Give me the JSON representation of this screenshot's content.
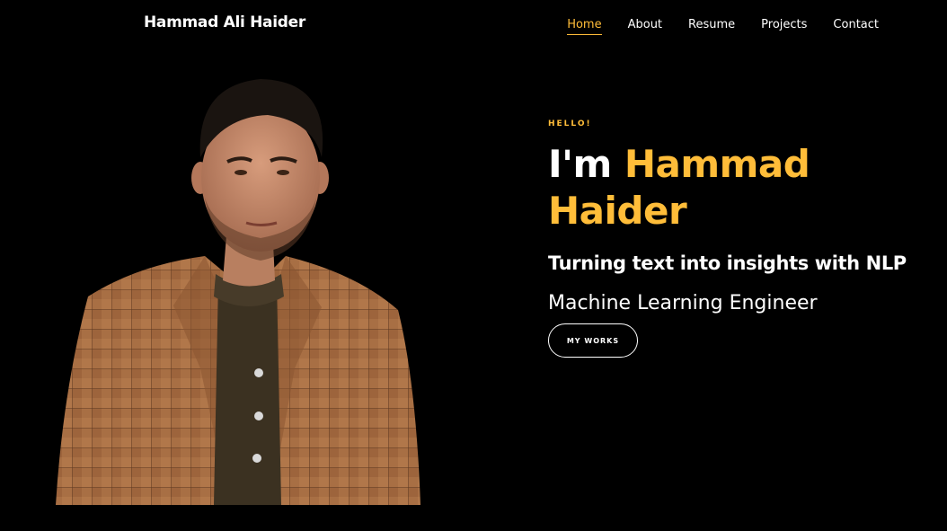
{
  "brand": "Hammad Ali Haider",
  "nav": {
    "items": [
      {
        "label": "Home",
        "active": true
      },
      {
        "label": "About",
        "active": false
      },
      {
        "label": "Resume",
        "active": false
      },
      {
        "label": "Projects",
        "active": false
      },
      {
        "label": "Contact",
        "active": false
      }
    ]
  },
  "hero": {
    "greeting": "HELLO!",
    "intro_prefix": "I'm",
    "name_first": "Hammad",
    "name_last": "Haider",
    "tagline": "Turning text into insights with NLP",
    "role": "Machine Learning Engineer",
    "cta_label": "MY WORKS"
  },
  "colors": {
    "accent": "#ffbd39",
    "background": "#000000",
    "text": "#ffffff"
  }
}
